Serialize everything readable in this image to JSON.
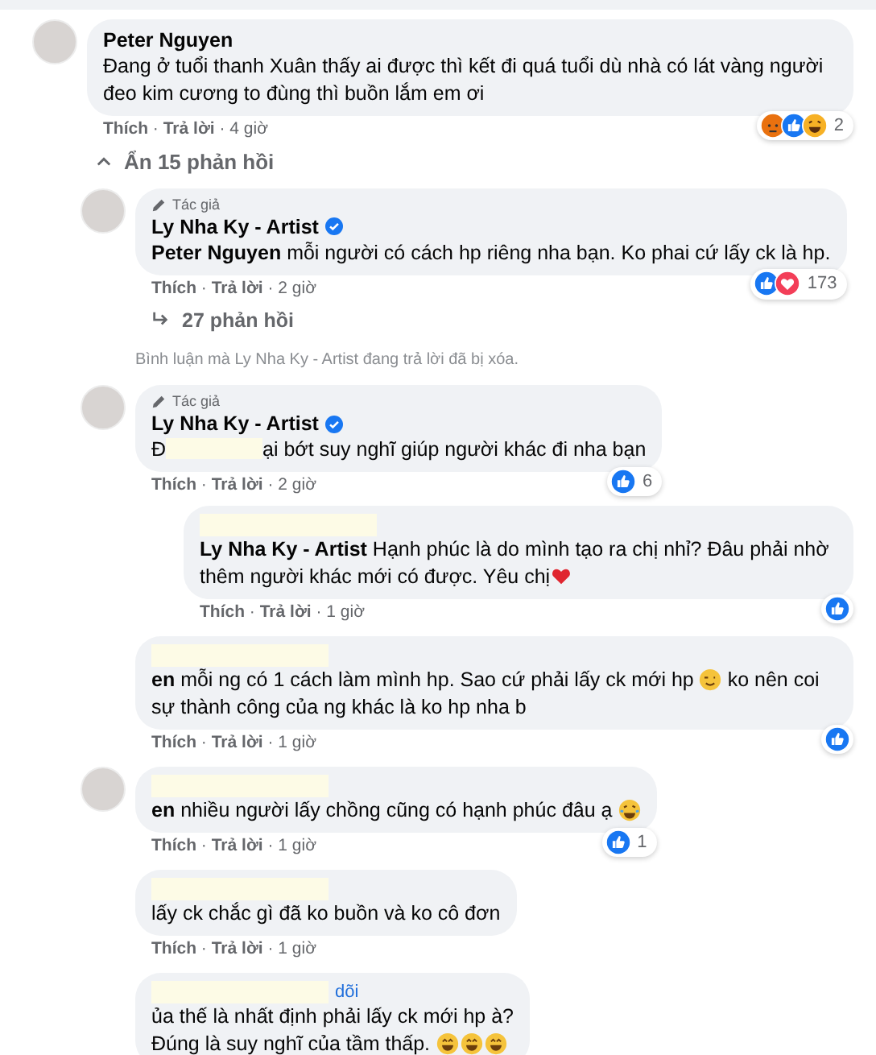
{
  "thread": {
    "kind": "comment",
    "avatar": true,
    "name": "Peter Nguyen",
    "body": [
      {
        "kind": "text",
        "text": "Đang ở tuổi thanh Xuân thấy ai được thì kết đi quá tuổi dù nhà có lát vàng người đeo kim cương to đùng thì buồn lắm em ơi"
      }
    ],
    "reactions": {
      "icons": [
        {
          "kind": "angry"
        },
        {
          "kind": "like"
        },
        {
          "kind": "haha"
        }
      ],
      "count": "2"
    },
    "actions": "**Thích** · **Trả lời** · 4 giờ",
    "toggle": {
      "label": "Ẩn 15 phản hồi",
      "expanded": true
    },
    "children": [
      {
        "kind": "comment",
        "avatar": true,
        "author_badge": "Tác giả",
        "name": "Ly Nha Ky - Artist",
        "verified": true,
        "body": [
          {
            "kind": "text",
            "text": "**Peter Nguyen** mỗi người có cách hp riêng nha bạn. Ko phai cứ lấy ck là hp."
          }
        ],
        "reactions": {
          "icons": [
            {
              "kind": "like"
            },
            {
              "kind": "love"
            }
          ],
          "count": "173"
        },
        "actions": "**Thích** · **Trả lời** · 2 giờ",
        "more_replies": "27 phản hồi"
      },
      {
        "kind": "note",
        "text": "Bình luận mà Ly Nha Ky - Artist đang trả lời đã bị xóa."
      },
      {
        "kind": "comment",
        "avatar": true,
        "author_badge": "Tác giả",
        "name": "Ly Nha Ky - Artist",
        "verified": true,
        "body": [
          {
            "kind": "text",
            "text": "Đ"
          },
          {
            "kind": "redacted"
          },
          {
            "kind": "text",
            "text": "ại bớt suy nghĩ giúp người khác đi nha bạn"
          }
        ],
        "reactions": {
          "icons": [
            {
              "kind": "like"
            }
          ],
          "count": "6"
        },
        "actions": "**Thích** · **Trả lời** · 2 giờ",
        "children": [
          {
            "kind": "comment",
            "redacted": true,
            "body": [
              {
                "kind": "text",
                "text": "**Ly Nha Ky - Artist** Hạnh phúc là do mình tạo ra chị nhỉ? Đâu phải nhờ thêm người khác mới có được. Yêu chị"
              },
              {
                "kind": "heart"
              }
            ],
            "reactions": {
              "icons": [
                {
                  "kind": "like"
                }
              ]
            },
            "actions": "**Thích** · **Trả lời** · 1 giờ"
          }
        ]
      },
      {
        "kind": "comment",
        "redacted": true,
        "body": [
          {
            "kind": "text",
            "text": "**en** mỗi ng có 1 cách làm mình hp. Sao cứ phải lấy ck mới hp "
          },
          {
            "kind": "wink"
          },
          {
            "kind": "text",
            "text": " ko nên coi sự thành công của ng khác là ko hp nha b"
          }
        ],
        "reactions": {
          "icons": [
            {
              "kind": "like"
            }
          ]
        },
        "actions": "**Thích** · **Trả lời** · 1 giờ"
      },
      {
        "kind": "comment",
        "avatar": true,
        "redacted": true,
        "body": [
          {
            "kind": "text",
            "text": "**en** nhiều người lấy chồng cũng có hạnh phúc đâu ạ "
          },
          {
            "kind": "tears"
          }
        ],
        "reactions": {
          "icons": [
            {
              "kind": "like"
            }
          ],
          "count": "1"
        },
        "actions": "**Thích** · **Trả lời** · 1 giờ"
      },
      {
        "kind": "comment",
        "redacted": true,
        "body": [
          {
            "kind": "text",
            "text": "lấy ck chắc gì đã ko buồn và ko cô đơn"
          }
        ],
        "actions": "**Thích** · **Trả lời** · 1 giờ"
      },
      {
        "kind": "comment",
        "redacted": true,
        "follow": "dõi",
        "body": [
          {
            "kind": "text",
            "text": "ủa thế là nhất định phải lấy ck mới hp à?"
          },
          {
            "kind": "line",
            "text": "Đúng là suy nghĩ của tầm thấp. "
          },
          {
            "kind": "grin"
          },
          {
            "kind": "grin"
          },
          {
            "kind": "grin"
          }
        ]
      }
    ]
  }
}
